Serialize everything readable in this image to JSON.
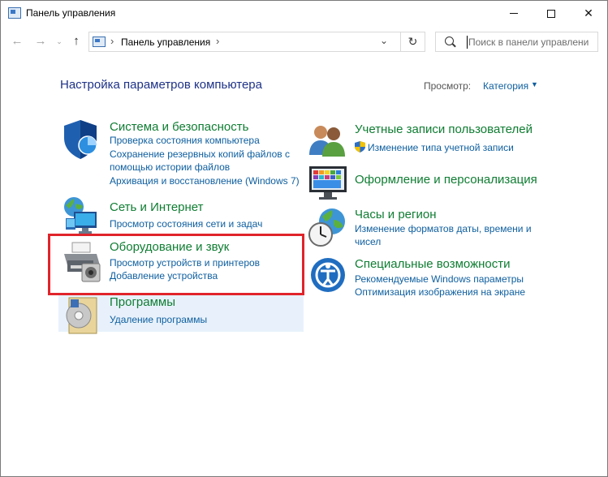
{
  "window": {
    "title": "Панель управления"
  },
  "navigation": {
    "back_icon": "arrow-left-icon",
    "forward_icon": "arrow-right-icon",
    "up_icon": "arrow-up-icon",
    "address_path": "Панель управления",
    "refresh_icon": "refresh-icon",
    "search_placeholder": "Поиск в панели управлени"
  },
  "header": {
    "heading": "Настройка параметров компьютера",
    "view_label": "Просмотр:",
    "view_value": "Категория"
  },
  "categories_left": [
    {
      "title": "Система и безопасность",
      "icon": "shield-icon",
      "links": [
        "Проверка состояния компьютера",
        "Сохранение резервных копий файлов с",
        "помощью истории файлов",
        "Архивация и восстановление (Windows 7)"
      ]
    },
    {
      "title": "Сеть и Интернет",
      "icon": "network-globe-icon",
      "links": [
        "Просмотр состояния сети и задач"
      ]
    },
    {
      "title": "Оборудование и звук",
      "icon": "printer-icon",
      "links": [
        "Просмотр устройств и принтеров",
        "Добавление устройства"
      ]
    },
    {
      "title": "Программы",
      "icon": "programs-disc-icon",
      "links": [
        "Удаление программы"
      ]
    }
  ],
  "categories_right": [
    {
      "title": "Учетные записи пользователей",
      "icon": "users-icon",
      "links": [
        "Изменение типа учетной записи"
      ]
    },
    {
      "title": "Оформление и персонализация",
      "icon": "monitor-palette-icon",
      "links": []
    },
    {
      "title": "Часы и регион",
      "icon": "clock-globe-icon",
      "links": [
        "Изменение форматов даты, времени и",
        "чисел"
      ]
    },
    {
      "title": "Специальные возможности",
      "icon": "accessibility-icon",
      "links": [
        "Рекомендуемые Windows параметры",
        "Оптимизация изображения на экране"
      ]
    }
  ],
  "colors": {
    "category_title": "#0f7d32",
    "link": "#0d5e9f",
    "heading": "#1e3287",
    "highlight_border": "#e0242a"
  }
}
